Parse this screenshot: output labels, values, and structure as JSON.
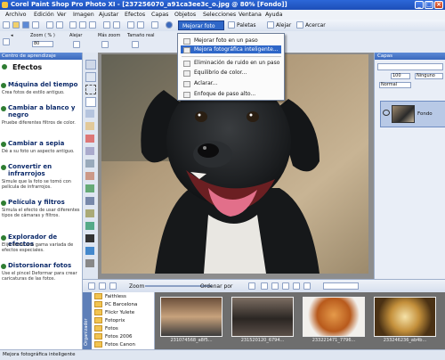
{
  "window": {
    "title": "Corel Paint Shop Pro Photo XI - [237256070_a91ca3ee3c_o.jpg @  80% [Fondo]]"
  },
  "menubar": {
    "items": [
      "Archivo",
      "Edición",
      "Ver",
      "Imagen",
      "Ajustar",
      "Efectos",
      "Capas",
      "Objetos",
      "Selecciones",
      "Ventana",
      "Ayuda"
    ]
  },
  "toolbar": {
    "enhance_label": "Mejorar foto",
    "palettes_label": "Paletas",
    "shrink_label": "Alejar",
    "zoom_label": "Acercar"
  },
  "tool_options": {
    "zoom_label": "Zoom ( % )",
    "zoom_value": "80",
    "zoom_out": "Alejar",
    "zoom_in": "Acercar",
    "fit_label": "Más zoom",
    "size_label": "Tamaño real"
  },
  "enhance_menu": {
    "items": [
      {
        "label": "Mejorar foto en un paso",
        "selected": false
      },
      {
        "label": "Mejora fotográfica inteligente...",
        "selected": true
      },
      {
        "label": "Eliminación de ruido en un paso",
        "selected": false
      },
      {
        "label": "Equilibrio de color...",
        "selected": false
      },
      {
        "label": "Aclarar...",
        "selected": false
      },
      {
        "label": "Enfoque de paso alto...",
        "selected": false
      }
    ]
  },
  "learning_center": {
    "header": "Centro de aprendizaje",
    "section_title": "Efectos",
    "topics": [
      {
        "title": "Máquina del tiempo",
        "desc": "Crea fotos de estilo antiguo."
      },
      {
        "title": "Cambiar a blanco y negro",
        "desc": "Pruebe diferentes filtros de color."
      },
      {
        "title": "Cambiar a sepia",
        "desc": "Dé a su foto un aspecto antiguo."
      },
      {
        "title": "Convertir en infrarrojos",
        "desc": "Simule que la foto se tomó con película de infrarrojos."
      },
      {
        "title": "Película y filtros",
        "desc": "Simula el efecto de usar diferentes tipos de cámaras y filtros."
      },
      {
        "title": "Explorador de efectos",
        "desc": "Elija entre una gama variada de efectos especiales."
      },
      {
        "title": "Distorsionar fotos",
        "desc": "Use el pincel Deformar para crear caricaturas de las fotos."
      }
    ]
  },
  "layers_panel": {
    "header": "Capas",
    "opacity": "100",
    "mode": "Normal",
    "blend_label": "Ninguno",
    "layer_name": "Fondo"
  },
  "organizer": {
    "zoom_label": "Zoom",
    "sort_label": "Ordenar por",
    "side_label": "Organizador",
    "folders": [
      "Faithless",
      "PC Barcelona",
      "Flickr Yulete",
      "Fotoprix",
      "Fotos",
      "Fotos 2006",
      "Fotos Canon"
    ],
    "thumbnails": [
      "231074568_a8f5...",
      "231520120_6794...",
      "233221471_7796...",
      "233246236_ab4b..."
    ]
  },
  "status": {
    "text": "Mejora fotográfica inteligente"
  },
  "colors": {
    "title_bar": "#2c67d8",
    "selection": "#2f67c8",
    "panel_header": "#3b69bd"
  }
}
